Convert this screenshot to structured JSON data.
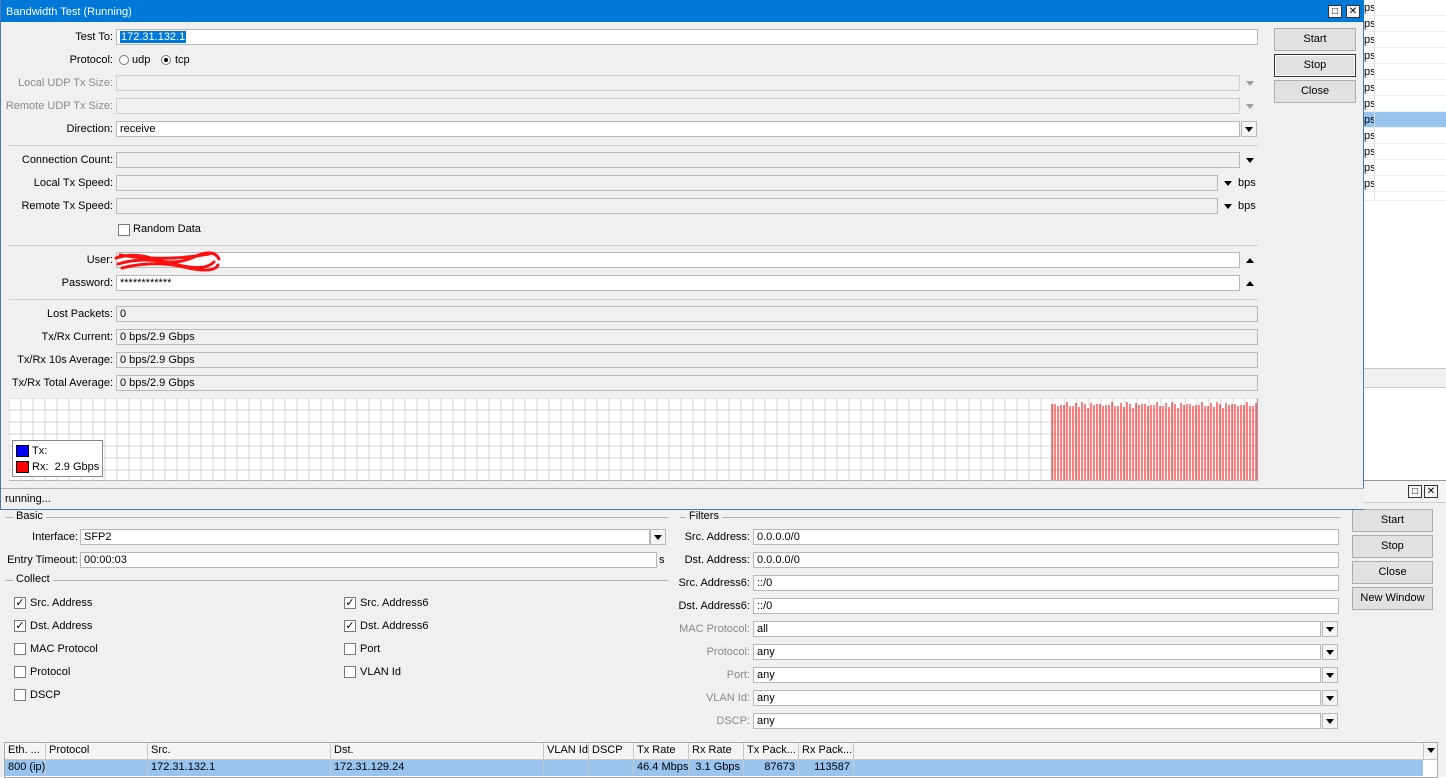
{
  "bg_list": {
    "rows": [
      "ps",
      "ps",
      "ps",
      "ps",
      "ps",
      "ps",
      "ps",
      "ps",
      "ps",
      "ps",
      "ps",
      "ps"
    ]
  },
  "bandwidth": {
    "title": "Bandwidth Test (Running)",
    "test_to_label": "Test To:",
    "test_to_value": "172.31.132.1",
    "protocol_label": "Protocol:",
    "protocol_udp": "udp",
    "protocol_tcp": "tcp",
    "protocol_selected": "tcp",
    "local_udp_label": "Local UDP Tx Size:",
    "remote_udp_label": "Remote UDP Tx Size:",
    "direction_label": "Direction:",
    "direction_value": "receive",
    "conn_count_label": "Connection Count:",
    "local_tx_label": "Local Tx Speed:",
    "remote_tx_label": "Remote Tx Speed:",
    "bps": "bps",
    "random_data": "Random Data",
    "user_label": "User:",
    "password_label": "Password:",
    "password_value": "************",
    "lost_label": "Lost Packets:",
    "lost_value": "0",
    "current_label": "Tx/Rx Current:",
    "current_value": "0 bps/2.9 Gbps",
    "avg10_label": "Tx/Rx 10s Average:",
    "avg10_value": "0 bps/2.9 Gbps",
    "total_label": "Tx/Rx Total Average:",
    "total_value": "0 bps/2.9 Gbps",
    "legend_tx": "Tx:",
    "legend_rx": "Rx:  2.9 Gbps",
    "status": "running...",
    "buttons": {
      "start": "Start",
      "stop": "Stop",
      "close": "Close"
    },
    "colors": {
      "tx": "#0000ff",
      "rx": "#ff0000",
      "title_accent": "#0078d7"
    }
  },
  "torch": {
    "basic_title": "Basic",
    "interface_label": "Interface:",
    "interface_value": "SFP2",
    "timeout_label": "Entry Timeout:",
    "timeout_value": "00:00:03",
    "timeout_unit": "s",
    "collect_title": "Collect",
    "collect": [
      {
        "label": "Src. Address",
        "checked": true
      },
      {
        "label": "Src. Address6",
        "checked": true
      },
      {
        "label": "Dst. Address",
        "checked": true
      },
      {
        "label": "Dst. Address6",
        "checked": true
      },
      {
        "label": "MAC Protocol",
        "checked": false
      },
      {
        "label": "Port",
        "checked": false
      },
      {
        "label": "Protocol",
        "checked": false
      },
      {
        "label": "VLAN Id",
        "checked": false
      },
      {
        "label": "DSCP",
        "checked": false
      }
    ],
    "filters_title": "Filters",
    "filters": {
      "src_label": "Src. Address:",
      "src_value": "0.0.0.0/0",
      "dst_label": "Dst. Address:",
      "dst_value": "0.0.0.0/0",
      "src6_label": "Src. Address6:",
      "src6_value": "::/0",
      "dst6_label": "Dst. Address6:",
      "dst6_value": "::/0",
      "mac_label": "MAC Protocol:",
      "mac_value": "all",
      "proto_label": "Protocol:",
      "proto_value": "any",
      "port_label": "Port:",
      "port_value": "any",
      "vlan_label": "VLAN Id:",
      "vlan_value": "any",
      "dscp_label": "DSCP:",
      "dscp_value": "any"
    },
    "buttons": {
      "start": "Start",
      "stop": "Stop",
      "close": "Close",
      "new_window": "New Window"
    },
    "table": {
      "columns": [
        "Eth. ...",
        "Protocol",
        "Src.",
        "Dst.",
        "VLAN Id",
        "DSCP",
        "Tx Rate",
        "Rx Rate",
        "Tx Pack...",
        "Rx Pack..."
      ],
      "rows": [
        [
          "800 (ip)",
          "",
          "172.31.132.1",
          "172.31.129.24",
          "",
          "",
          "46.4 Mbps",
          "3.1 Gbps",
          "87673",
          "113587"
        ]
      ]
    }
  }
}
